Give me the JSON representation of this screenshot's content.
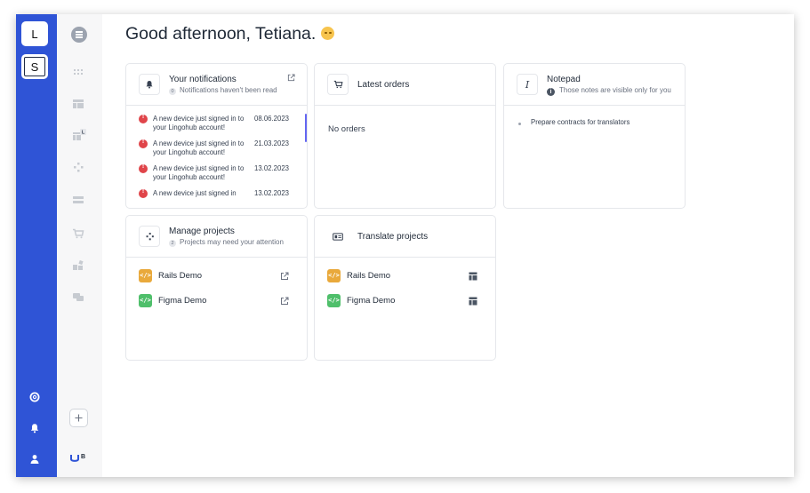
{
  "workspaces": [
    {
      "label": "L",
      "selected": false
    },
    {
      "label": "S",
      "selected": true
    }
  ],
  "rail_icons": [
    "support-icon",
    "bell-icon",
    "user-icon"
  ],
  "nav": {
    "items": [
      "dashboard",
      "apps-grid",
      "projects",
      "projects-local",
      "integrations",
      "storage",
      "orders",
      "widgets",
      "chat"
    ],
    "add_icon": "plus-icon",
    "brand_badge": "B"
  },
  "greeting": "Good afternoon, Tetiana.",
  "cards": {
    "notifications": {
      "title": "Your notifications",
      "count": "0",
      "subtitle": "Notifications haven't been read",
      "items": [
        {
          "text": "A new device just signed in to your Lingohub account!",
          "date": "08.06.2023"
        },
        {
          "text": "A new device just signed in to your Lingohub account!",
          "date": "21.03.2023"
        },
        {
          "text": "A new device just signed in to your Lingohub account!",
          "date": "13.02.2023"
        },
        {
          "text": "A new device just signed in",
          "date": "13.02.2023"
        }
      ]
    },
    "orders": {
      "title": "Latest orders",
      "empty": "No orders"
    },
    "notepad": {
      "title": "Notepad",
      "subtitle": "Those notes are visible only for you",
      "notes": [
        "Prepare contracts for translators"
      ]
    },
    "manage": {
      "title": "Manage projects",
      "count": "2",
      "subtitle": "Projects may need your attention",
      "projects": [
        {
          "name": "Rails Demo",
          "color": "#e9a93b"
        },
        {
          "name": "Figma Demo",
          "color": "#4fbf6b"
        }
      ]
    },
    "translate": {
      "title": "Translate projects",
      "projects": [
        {
          "name": "Rails Demo",
          "color": "#e9a93b"
        },
        {
          "name": "Figma Demo",
          "color": "#4fbf6b"
        }
      ]
    }
  },
  "colors": {
    "rail": "#2f54d6",
    "accent": "#6366f1",
    "warn": "#e0454a"
  }
}
